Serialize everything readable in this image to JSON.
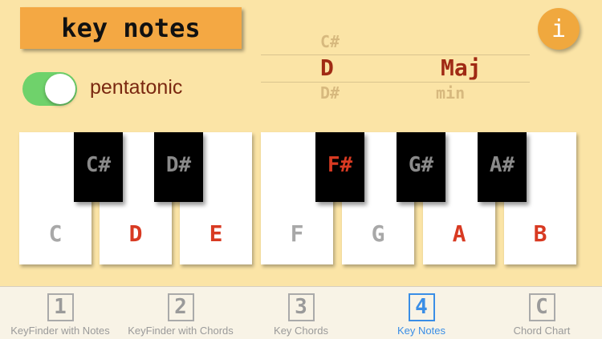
{
  "title": "key notes",
  "info_label": "i",
  "pentatonic": {
    "label": "pentatonic",
    "on": true
  },
  "picker": {
    "note_above": "C#",
    "note_selected": "D",
    "note_below": "D#",
    "mode_selected": "Maj",
    "mode_below": "min"
  },
  "keyboard": {
    "white_keys": [
      {
        "note": "C",
        "highlighted": false
      },
      {
        "note": "D",
        "highlighted": true
      },
      {
        "note": "E",
        "highlighted": true
      },
      {
        "note": "F",
        "highlighted": false
      },
      {
        "note": "G",
        "highlighted": false
      },
      {
        "note": "A",
        "highlighted": true
      },
      {
        "note": "B",
        "highlighted": true
      }
    ],
    "black_keys": [
      {
        "note": "C#",
        "highlighted": false
      },
      {
        "note": "D#",
        "highlighted": false
      },
      {
        "note": "F#",
        "highlighted": true
      },
      {
        "note": "G#",
        "highlighted": false
      },
      {
        "note": "A#",
        "highlighted": false
      }
    ],
    "colors": {
      "highlight": "#d83a22",
      "normal_white": "#a8a8a8",
      "normal_black": "#8a8a8a"
    }
  },
  "tabs": [
    {
      "num": "1",
      "label": "KeyFinder with Notes",
      "active": false
    },
    {
      "num": "2",
      "label": "KeyFinder with Chords",
      "active": false
    },
    {
      "num": "3",
      "label": "Key Chords",
      "active": false
    },
    {
      "num": "4",
      "label": "Key Notes",
      "active": true
    },
    {
      "num": "C",
      "label": "Chord Chart",
      "active": false
    }
  ]
}
